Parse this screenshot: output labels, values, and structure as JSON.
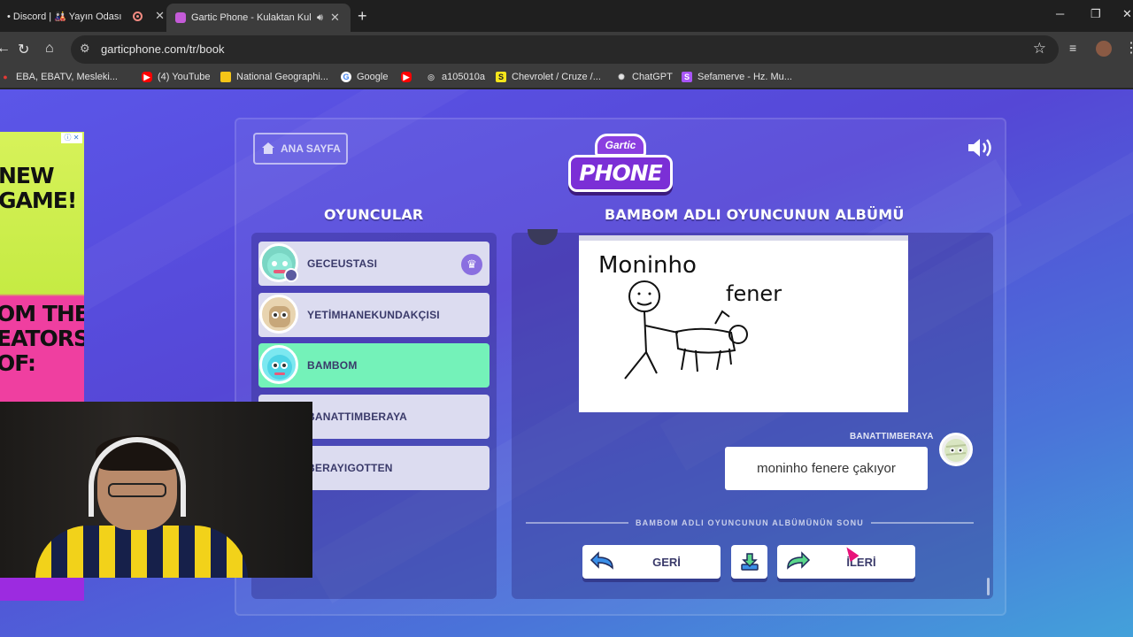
{
  "browser": {
    "tabs": [
      {
        "label": "• Discord | 🎎 Yayın Odası",
        "active": false
      },
      {
        "label": "Gartic Phone - Kulaktan Kul",
        "active": true
      }
    ],
    "url": "garticphone.com/tr/book",
    "bookmarks": [
      {
        "label": "EBA, EBATV, Mesleki...",
        "icon": "eba-icon",
        "color": "#e53935"
      },
      {
        "label": "(4) YouTube",
        "icon": "youtube-icon",
        "color": "#ff0000"
      },
      {
        "label": "National Geographi...",
        "icon": "natgeo-icon",
        "color": "#f5c518"
      },
      {
        "label": "Google",
        "icon": "google-icon",
        "color": "#4285f4"
      },
      {
        "label": "",
        "icon": "youtube-icon",
        "color": "#ff0000"
      },
      {
        "label": "a105010a",
        "icon": "globe-icon",
        "color": "#9e9e9e"
      },
      {
        "label": "Chevrolet / Cruze /...",
        "icon": "s-icon",
        "color": "#f5e51b"
      },
      {
        "label": "ChatGPT",
        "icon": "chatgpt-icon",
        "color": "#e3e3e3"
      },
      {
        "label": "Sefamerve - Hz. Mu...",
        "icon": "s-icon",
        "color": "#a855f7"
      }
    ]
  },
  "ad": {
    "line1": "NEW\nGAME!",
    "line2": "OM THE\nEATORS\nOF:"
  },
  "game": {
    "home_button": "ANA SAYFA",
    "logo_top": "Gartic",
    "logo_main": "PHONE",
    "players_title": "OYUNCULAR",
    "album_title": "BAMBOM ADLI OYUNCUNUN ALBÜMÜ",
    "players": [
      {
        "name": "GECEUSTASI",
        "host": true,
        "active": false
      },
      {
        "name": "YETİMHANEKUNDAKÇISI",
        "host": false,
        "active": false
      },
      {
        "name": "BAMBOM",
        "host": false,
        "active": true
      },
      {
        "name": "BANATTIMBERAYA",
        "host": false,
        "active": false
      },
      {
        "name": "BERAYIGOTTEN",
        "host": false,
        "active": false
      }
    ],
    "drawing_text": [
      "Moninho",
      "fener"
    ],
    "guess": {
      "author": "BANATTIMBERAYA",
      "text": "moninho fenere çakıyor"
    },
    "album_end": "BAMBOM ADLI OYUNCUNUN ALBÜMÜNÜN SONU",
    "back_label": "GERİ",
    "forward_label": "İLERİ"
  },
  "colors": {
    "accent_green": "#74f2b9",
    "background_start": "#5b56e8",
    "background_end": "#43a1da"
  }
}
